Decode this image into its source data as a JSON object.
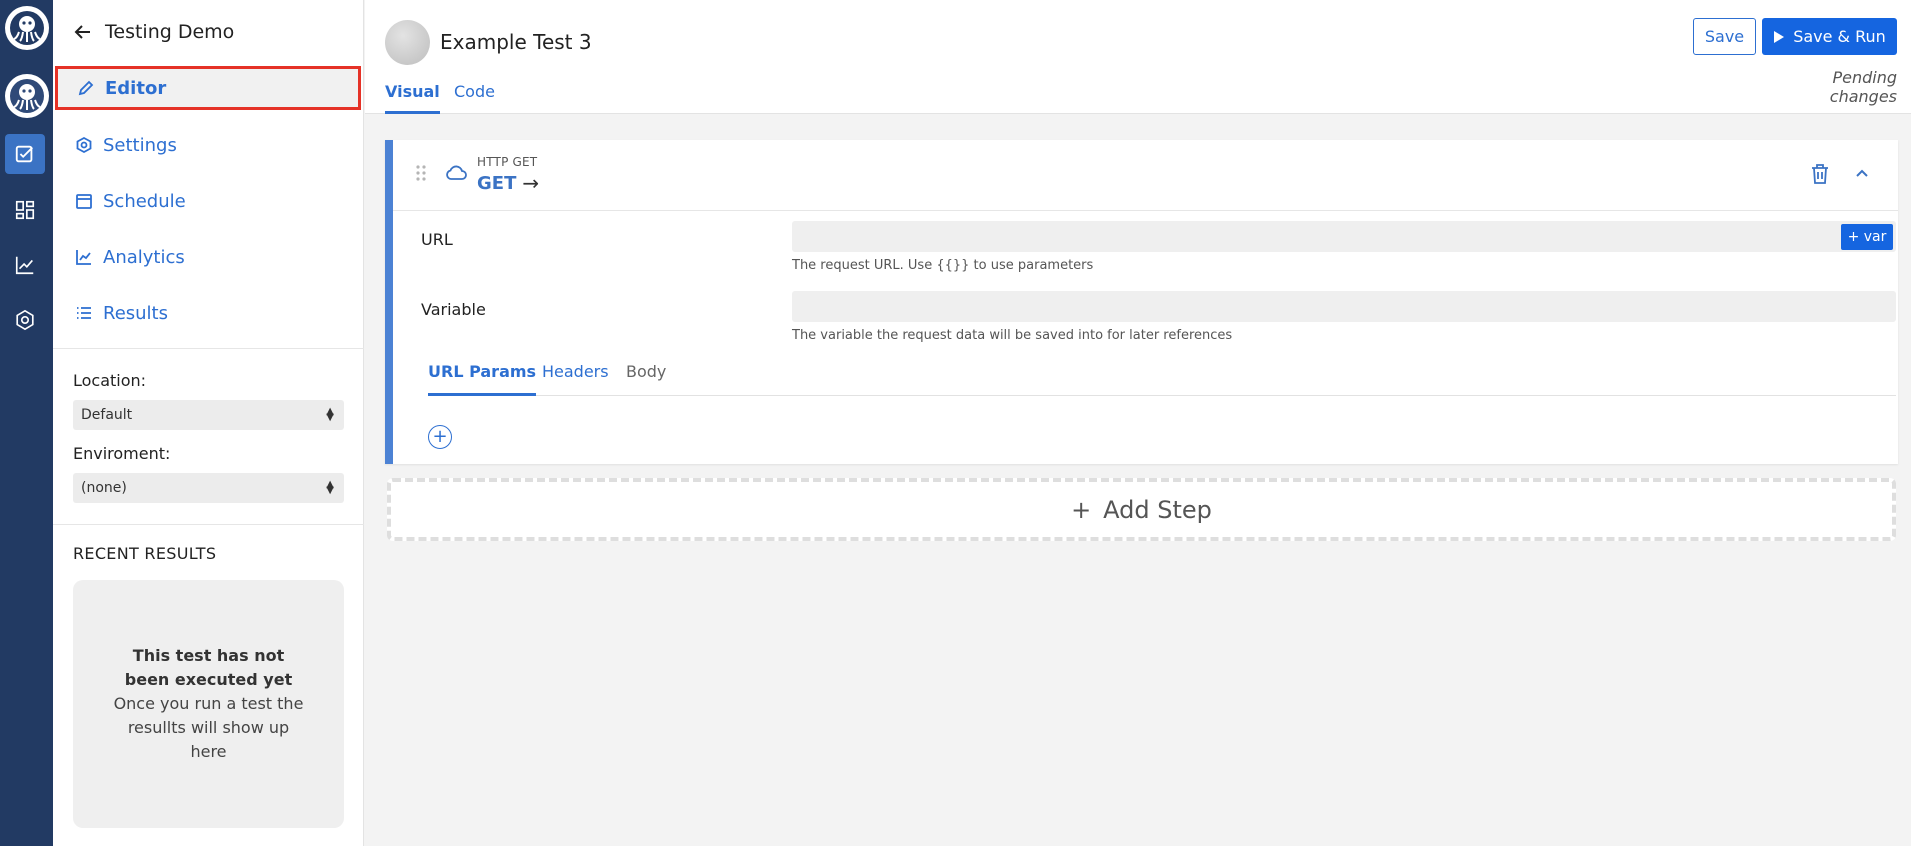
{
  "app": {
    "project_title": "Testing Demo"
  },
  "nav": {
    "items": [
      {
        "label": "Editor",
        "icon": "pencil-icon",
        "active": true
      },
      {
        "label": "Settings",
        "icon": "gear-icon"
      },
      {
        "label": "Schedule",
        "icon": "calendar-icon"
      },
      {
        "label": "Analytics",
        "icon": "chart-line-icon"
      },
      {
        "label": "Results",
        "icon": "list-icon"
      }
    ]
  },
  "config": {
    "location_label": "Location:",
    "location_value": "Default",
    "environment_label": "Enviroment:",
    "environment_value": "(none)"
  },
  "recent": {
    "title": "RECENT RESULTS",
    "empty_title": "This test has not been executed yet",
    "empty_text": "Once you run a test the resullts will show up here"
  },
  "header": {
    "test_name": "Example Test 3",
    "tabs": [
      {
        "label": "Visual",
        "active": true
      },
      {
        "label": "Code"
      }
    ],
    "save_label": "Save",
    "save_run_label": "Save & Run",
    "status": "Pending changes"
  },
  "step": {
    "type_label": "HTTP GET",
    "method": "GET",
    "arrow": "→",
    "url_label": "URL",
    "url_value": "",
    "url_help": "The request URL. Use {{}} to use parameters",
    "var_button": "+ var",
    "variable_label": "Variable",
    "variable_value": "",
    "variable_help": "The variable the request data will be saved into for later references",
    "subtabs": [
      {
        "label": "URL Params",
        "active": true
      },
      {
        "label": "Headers"
      },
      {
        "label": "Body"
      }
    ],
    "add_param": "+"
  },
  "add_step": {
    "plus": "+",
    "label": "Add Step"
  },
  "colors": {
    "rail_bg": "#223a63",
    "accent": "#2d6fd1",
    "primary_button": "#1565e0",
    "active_outline": "#e53227"
  }
}
